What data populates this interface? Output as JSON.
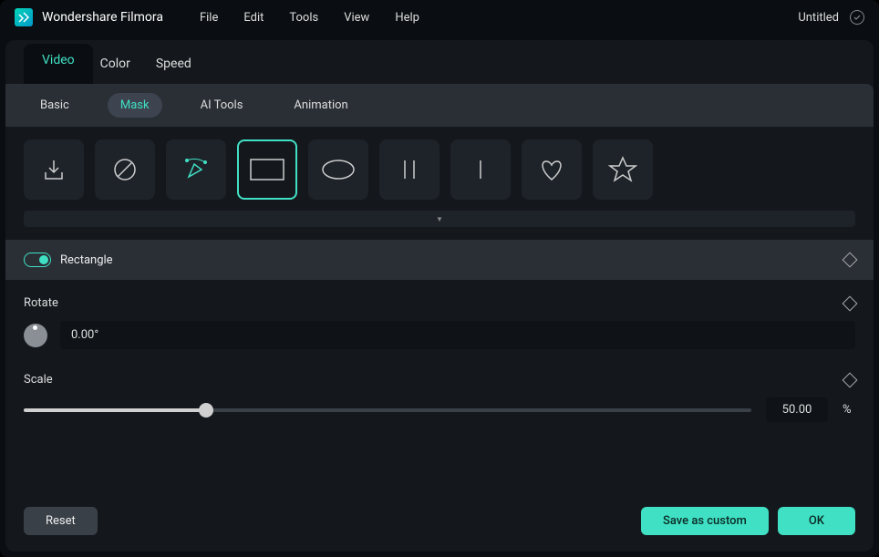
{
  "app_name": "Wondershare Filmora",
  "menu": [
    "File",
    "Edit",
    "Tools",
    "View",
    "Help"
  ],
  "document_title": "Untitled",
  "top_tabs": [
    {
      "label": "Video",
      "active": true
    },
    {
      "label": "Color",
      "active": false
    },
    {
      "label": "Speed",
      "active": false
    }
  ],
  "sub_tabs": [
    {
      "label": "Basic",
      "active": false
    },
    {
      "label": "Mask",
      "active": true
    },
    {
      "label": "AI Tools",
      "active": false
    },
    {
      "label": "Animation",
      "active": false
    }
  ],
  "shapes": [
    {
      "name": "import-icon"
    },
    {
      "name": "none-icon"
    },
    {
      "name": "pen-icon"
    },
    {
      "name": "rectangle-icon",
      "selected": true
    },
    {
      "name": "ellipse-icon"
    },
    {
      "name": "double-line-icon"
    },
    {
      "name": "single-line-icon"
    },
    {
      "name": "heart-icon"
    },
    {
      "name": "star-icon"
    }
  ],
  "section": {
    "title": "Rectangle",
    "enabled": true
  },
  "rotate": {
    "label": "Rotate",
    "value": "0.00°"
  },
  "scale": {
    "label": "Scale",
    "value": "50.00",
    "unit": "%",
    "percent": 25
  },
  "footer": {
    "reset": "Reset",
    "save_custom": "Save as custom",
    "ok": "OK"
  }
}
